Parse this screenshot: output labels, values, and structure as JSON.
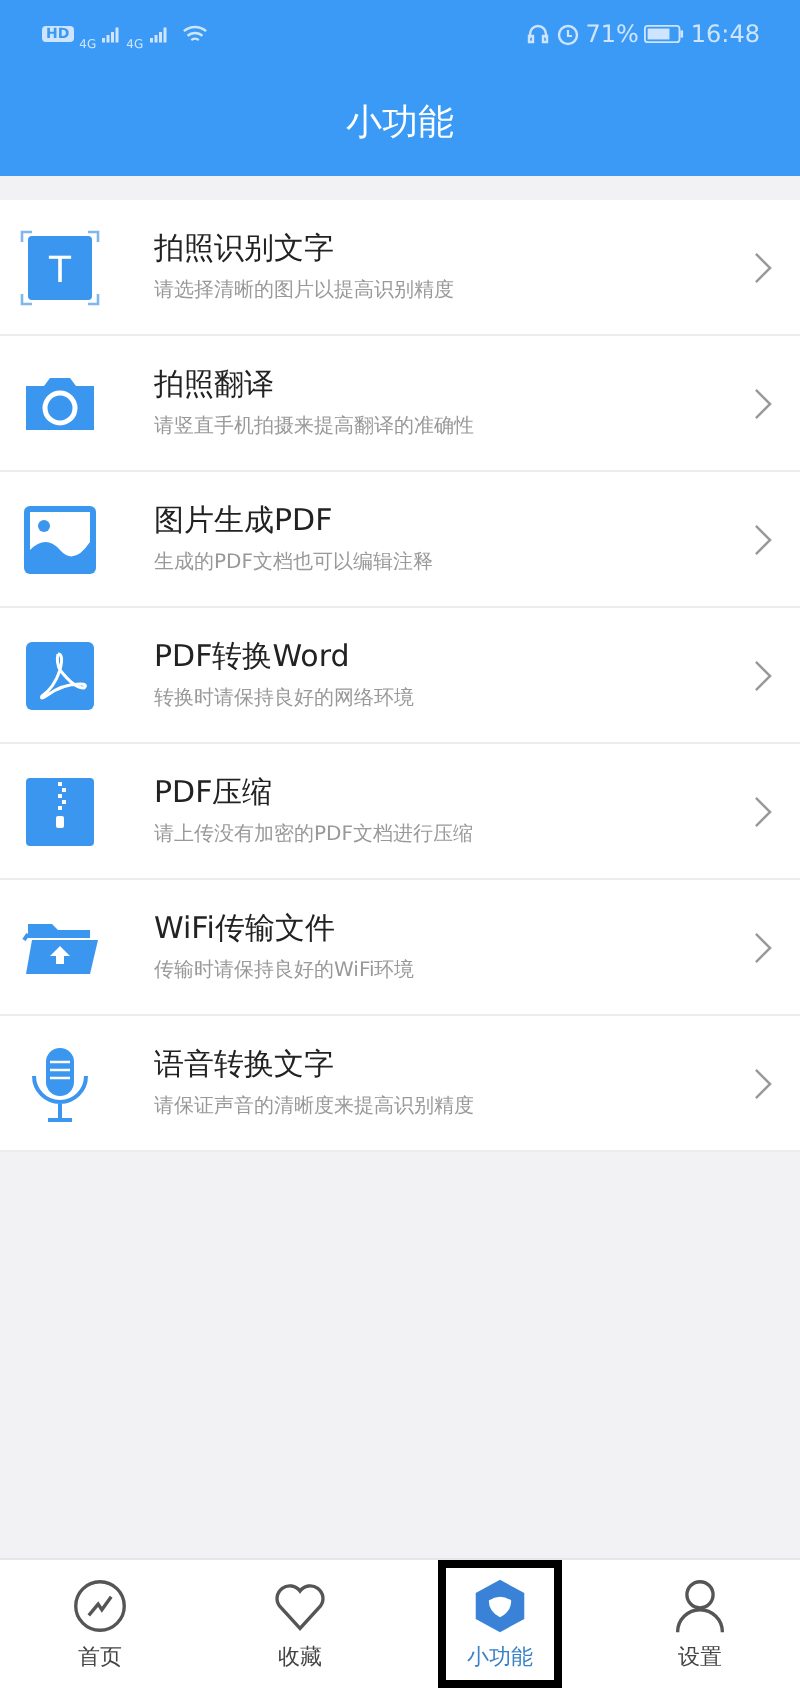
{
  "status_bar": {
    "left": [
      "HD",
      "4G",
      "4G"
    ],
    "battery_text": "71%",
    "time": "16:48"
  },
  "title": "小功能",
  "features": [
    {
      "kind": "text-scan",
      "title": "拍照识别文字",
      "subtitle": "请选择清晰的图片以提高识别精度",
      "icon_text": "T"
    },
    {
      "kind": "camera",
      "title": "拍照翻译",
      "subtitle": "请竖直手机拍摄来提高翻译的准确性"
    },
    {
      "kind": "image",
      "title": "图片生成PDF",
      "subtitle": "生成的PDF文档也可以编辑注释"
    },
    {
      "kind": "pdf",
      "title": "PDF转换Word",
      "subtitle": "转换时请保持良好的网络环境"
    },
    {
      "kind": "zip",
      "title": "PDF压缩",
      "subtitle": "请上传没有加密的PDF文档进行压缩"
    },
    {
      "kind": "folder",
      "title": "WiFi传输文件",
      "subtitle": "传输时请保持良好的WiFi环境"
    },
    {
      "kind": "mic",
      "title": "语音转换文字",
      "subtitle": "请保证声音的清晰度来提高识别精度"
    }
  ],
  "tabs": [
    {
      "kind": "home",
      "label": "首页",
      "selected": false,
      "highlighted": false
    },
    {
      "kind": "favorites",
      "label": "收藏",
      "selected": false,
      "highlighted": false
    },
    {
      "kind": "tools",
      "label": "小功能",
      "selected": true,
      "highlighted": true
    },
    {
      "kind": "settings",
      "label": "设置",
      "selected": false,
      "highlighted": false
    }
  ]
}
